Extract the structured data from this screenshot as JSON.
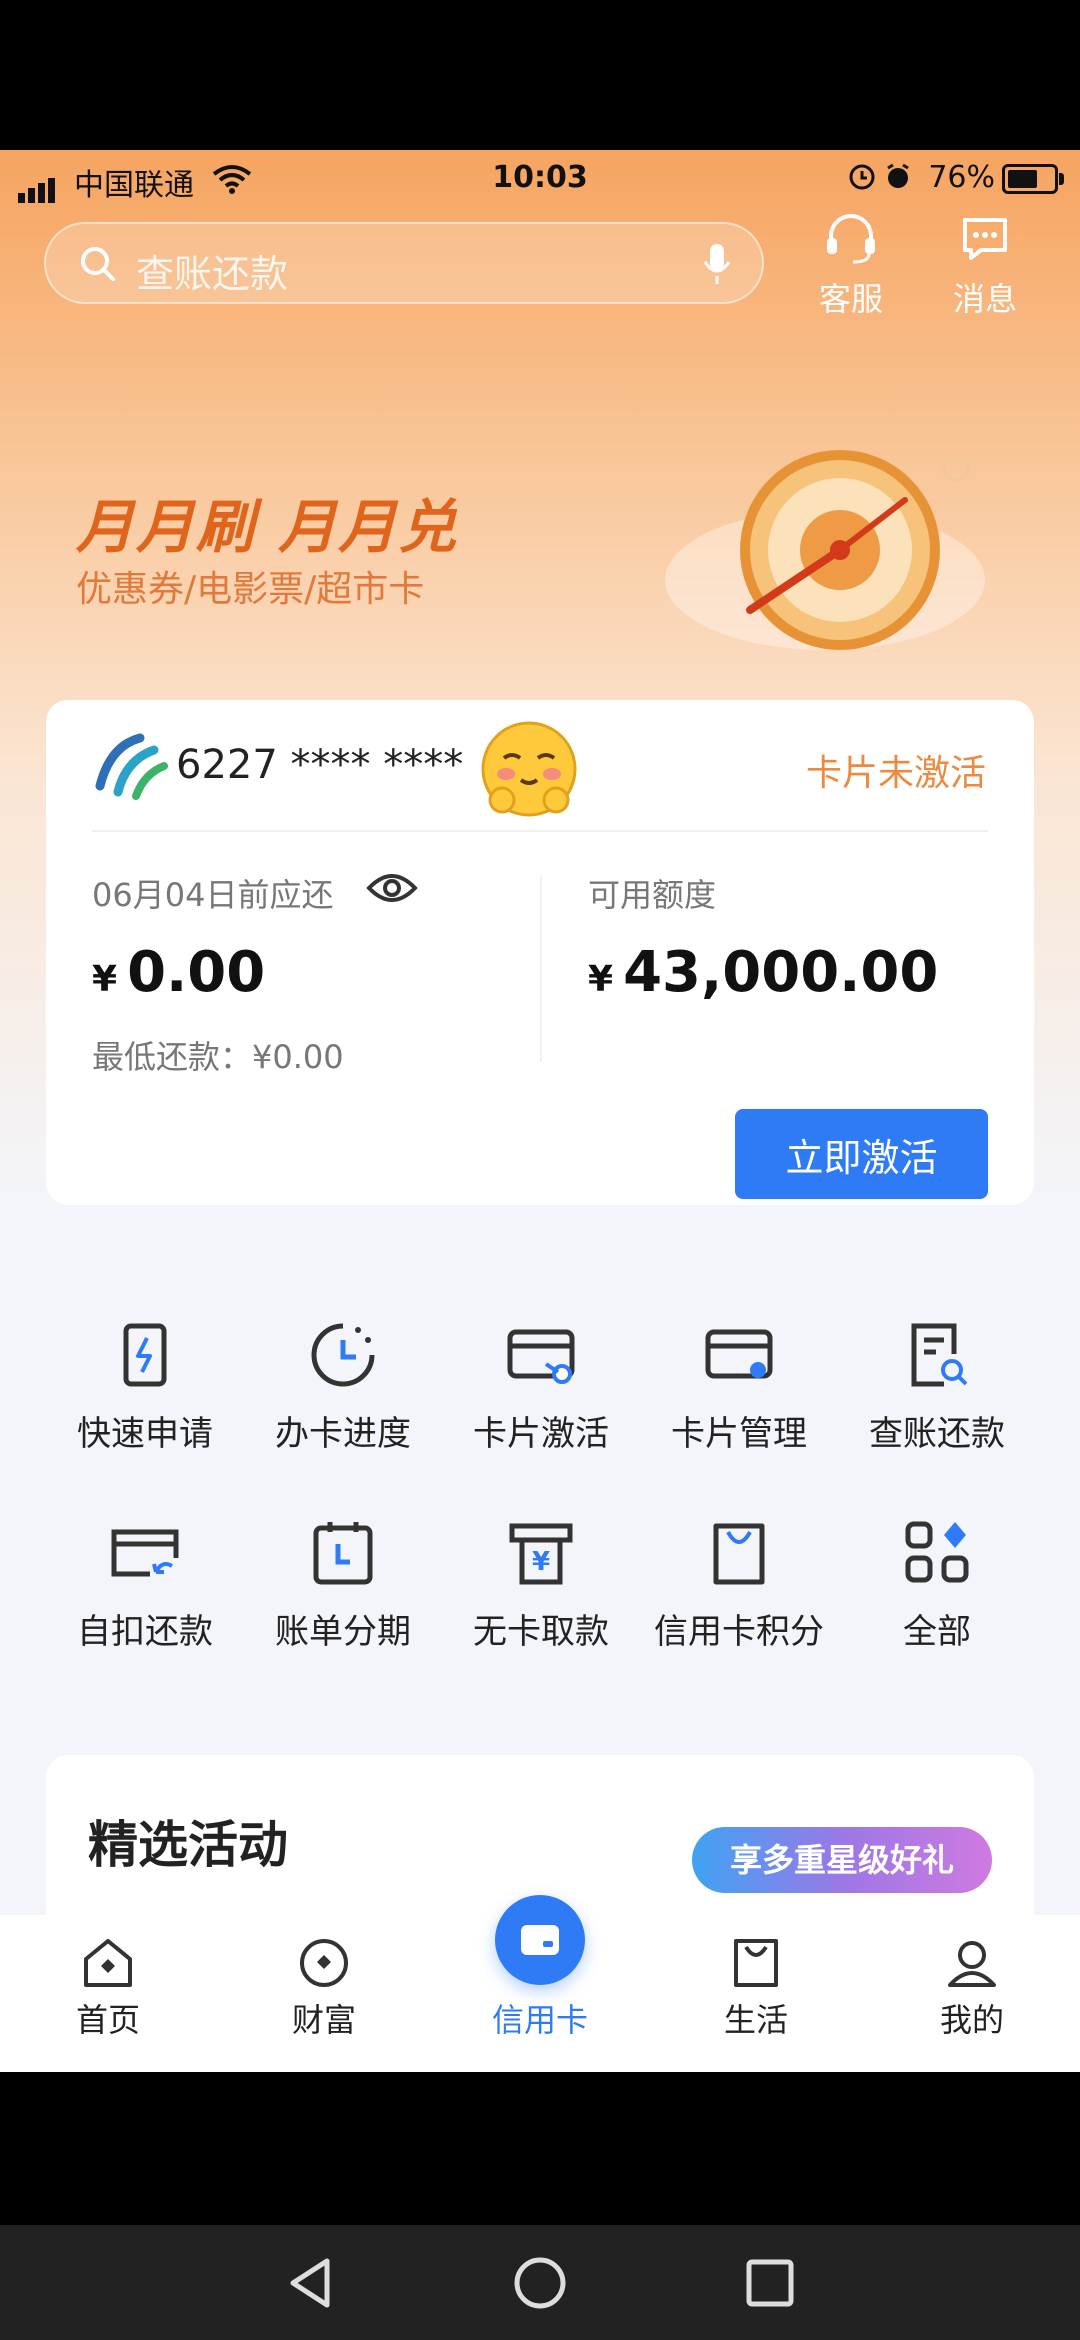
{
  "status_bar": {
    "carrier": "中国联通",
    "time": "10:03",
    "battery": "76%",
    "battery_level": 0.76
  },
  "search": {
    "placeholder": "查账还款"
  },
  "top_actions": [
    {
      "label": "客服",
      "icon": "headset-icon"
    },
    {
      "label": "消息",
      "icon": "message-icon"
    }
  ],
  "banner": {
    "title": "月月刷  月月兑",
    "subtitle": "优惠券/电影票/超市卡"
  },
  "card": {
    "number": "6227 **** ****",
    "status": "卡片未激活",
    "due_label": "06月04日前应还",
    "due_currency": "¥",
    "due_amount": "0.00",
    "min_payment": "最低还款：¥0.00",
    "limit_label": "可用额度",
    "limit_currency": "¥",
    "limit_amount": "43,000.00",
    "activate_button": "立即激活"
  },
  "shortcuts": [
    {
      "label": "快速申请",
      "icon": "quick-apply-icon"
    },
    {
      "label": "办卡进度",
      "icon": "progress-clock-icon"
    },
    {
      "label": "卡片激活",
      "icon": "card-activate-icon"
    },
    {
      "label": "卡片管理",
      "icon": "card-manage-icon"
    },
    {
      "label": "查账还款",
      "icon": "bill-search-icon"
    },
    {
      "label": "自扣还款",
      "icon": "auto-repay-icon"
    },
    {
      "label": "账单分期",
      "icon": "installment-icon"
    },
    {
      "label": "无卡取款",
      "icon": "cardless-withdraw-icon"
    },
    {
      "label": "信用卡积分",
      "icon": "points-bag-icon"
    },
    {
      "label": "全部",
      "icon": "all-apps-icon"
    }
  ],
  "featured": {
    "title": "精选活动",
    "badge": "享多重星级好礼"
  },
  "tabs": [
    {
      "label": "首页",
      "icon": "home-icon"
    },
    {
      "label": "财富",
      "icon": "wealth-icon"
    },
    {
      "label": "信用卡",
      "icon": "credit-card-icon",
      "active": true
    },
    {
      "label": "生活",
      "icon": "life-bag-icon"
    },
    {
      "label": "我的",
      "icon": "profile-icon"
    }
  ],
  "colors": {
    "accent": "#2f7bf5",
    "banner_orange": "#e0651c",
    "status_orange": "#ec8a3f"
  }
}
